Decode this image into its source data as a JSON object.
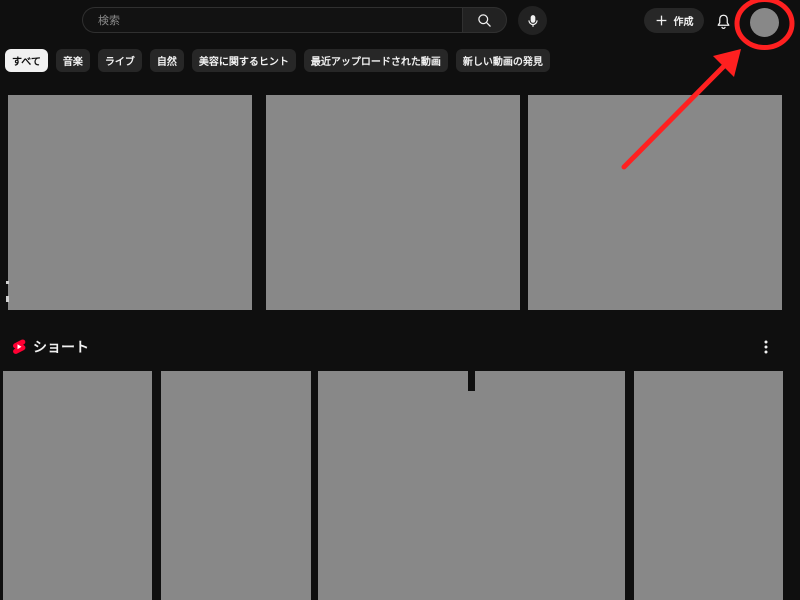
{
  "header": {
    "search_placeholder": "検索",
    "search_icon": "search-icon",
    "mic_icon": "mic-icon",
    "create_label": "作成",
    "create_icon": "plus-icon",
    "notifications_icon": "bell-icon",
    "avatar": "avatar"
  },
  "chips": [
    {
      "label": "すべて",
      "active": true
    },
    {
      "label": "音楽",
      "active": false
    },
    {
      "label": "ライブ",
      "active": false
    },
    {
      "label": "自然",
      "active": false
    },
    {
      "label": "美容に関するヒント",
      "active": false
    },
    {
      "label": "最近アップロードされた動画",
      "active": false
    },
    {
      "label": "新しい動画の発見",
      "active": false
    }
  ],
  "shorts": {
    "title": "ショート",
    "icon": "shorts-icon",
    "more_icon": "more-vert-icon"
  },
  "annotation": {
    "color": "#ff2020",
    "target": "avatar"
  },
  "colors": {
    "background": "#0f0f0f",
    "chip": "#272727",
    "chip_active": "#f1f1f1",
    "thumbnail": "#888888",
    "shorts_red": "#ff0033",
    "annotation_red": "#ff2020"
  }
}
